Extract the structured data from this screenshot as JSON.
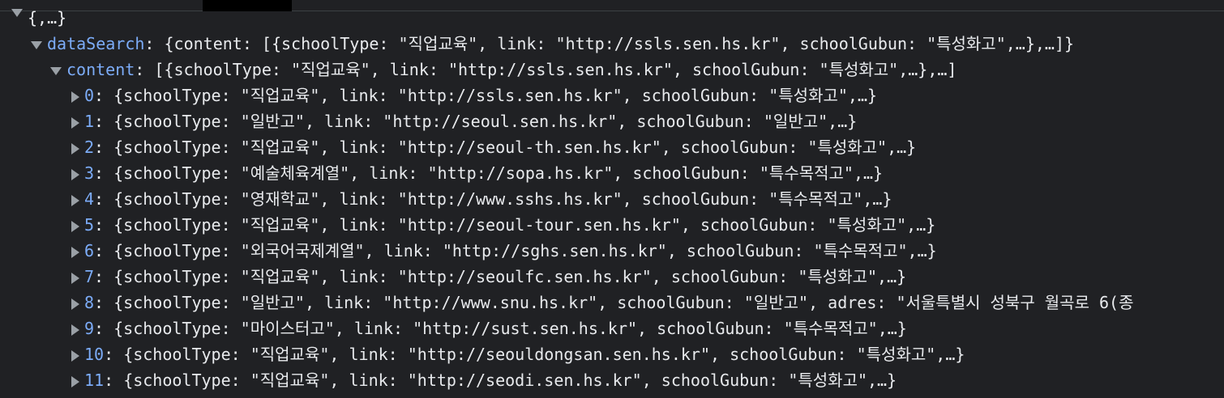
{
  "tree": {
    "root": {
      "label": "{,…}"
    },
    "dataSearch": {
      "key": "dataSearch",
      "summary": "{content: [{schoolType: \"직업교육\", link: \"http://ssls.sen.hs.kr\", schoolGubun: \"특성화고\",…},…]}"
    },
    "content": {
      "key": "content",
      "summary": "[{schoolType: \"직업교육\", link: \"http://ssls.sen.hs.kr\", schoolGubun: \"특성화고\",…},…]"
    },
    "items": [
      {
        "index": "0",
        "text": "{schoolType: \"직업교육\", link: \"http://ssls.sen.hs.kr\", schoolGubun: \"특성화고\",…}"
      },
      {
        "index": "1",
        "text": "{schoolType: \"일반고\", link: \"http://seoul.sen.hs.kr\", schoolGubun: \"일반고\",…}"
      },
      {
        "index": "2",
        "text": "{schoolType: \"직업교육\", link: \"http://seoul-th.sen.hs.kr\", schoolGubun: \"특성화고\",…}"
      },
      {
        "index": "3",
        "text": "{schoolType: \"예술체육계열\", link: \"http://sopa.hs.kr\", schoolGubun: \"특수목적고\",…}"
      },
      {
        "index": "4",
        "text": "{schoolType: \"영재학교\", link: \"http://www.sshs.hs.kr\", schoolGubun: \"특수목적고\",…}"
      },
      {
        "index": "5",
        "text": "{schoolType: \"직업교육\", link: \"http://seoul-tour.sen.hs.kr\", schoolGubun: \"특성화고\",…}"
      },
      {
        "index": "6",
        "text": "{schoolType: \"외국어국제계열\", link: \"http://sghs.sen.hs.kr\", schoolGubun: \"특수목적고\",…}"
      },
      {
        "index": "7",
        "text": "{schoolType: \"직업교육\", link: \"http://seoulfc.sen.hs.kr\", schoolGubun: \"특성화고\",…}"
      },
      {
        "index": "8",
        "text": "{schoolType: \"일반고\", link: \"http://www.snu.hs.kr\", schoolGubun: \"일반고\", adres: \"서울특별시 성북구 월곡로 6(종"
      },
      {
        "index": "9",
        "text": "{schoolType: \"마이스터고\", link: \"http://sust.sen.hs.kr\", schoolGubun: \"특수목적고\",…}"
      },
      {
        "index": "10",
        "text": "{schoolType: \"직업교육\", link: \"http://seouldongsan.sen.hs.kr\", schoolGubun: \"특성화고\",…}"
      },
      {
        "index": "11",
        "text": "{schoolType: \"직업교육\", link: \"http://seodi.sen.hs.kr\", schoolGubun: \"특성화고\",…}"
      }
    ]
  },
  "colors": {
    "background": "#202124",
    "key": "#7cacf8",
    "text": "#e8eaed",
    "triangle": "#9aa0a6"
  },
  "icons": {
    "expanded": "triangle-down-icon",
    "collapsed": "triangle-right-icon"
  }
}
